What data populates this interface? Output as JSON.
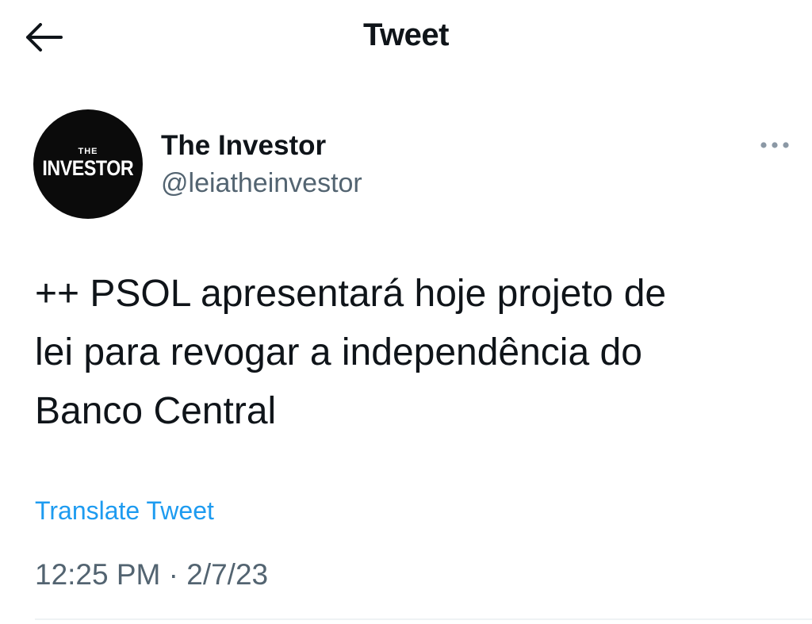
{
  "header": {
    "back_icon": "arrow-left-icon",
    "title": "Tweet"
  },
  "tweet": {
    "author": {
      "avatar_icon": "the-investor-logo",
      "avatar_text_top": "THE",
      "avatar_text_main": "INVESTOR",
      "display_name": "The Investor",
      "handle": "@leiatheinvestor"
    },
    "more_icon": "more-horizontal-icon",
    "text": "++ PSOL apresentará hoje projeto de\nlei para revogar a independência do\nBanco Central",
    "translate_label": "Translate Tweet",
    "timestamp": "12:25 PM · 2/7/23"
  },
  "colors": {
    "text_primary": "#0f1419",
    "text_secondary": "#536471",
    "link": "#1d9bf0",
    "avatar_bg": "#0b0b0b",
    "divider": "#eff3f4"
  }
}
